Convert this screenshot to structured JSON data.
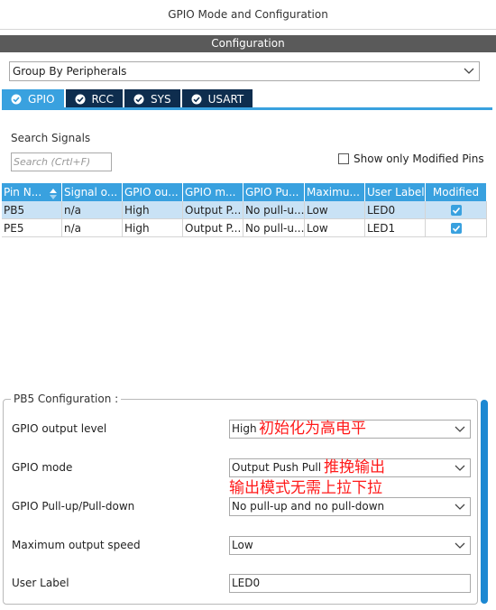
{
  "window": {
    "title": "GPIO Mode and Configuration"
  },
  "config": {
    "header": "Configuration"
  },
  "group_select": {
    "value": "Group By Peripherals"
  },
  "tabs": [
    {
      "label": "GPIO",
      "active": true
    },
    {
      "label": "RCC",
      "active": false
    },
    {
      "label": "SYS",
      "active": false
    },
    {
      "label": "USART",
      "active": false
    }
  ],
  "search": {
    "label": "Search Signals",
    "placeholder": "Search (Crtl+F)",
    "show_modified_label": "Show only Modified Pins"
  },
  "table": {
    "headers": [
      "Pin N...",
      "Signal o...",
      "GPIO ou...",
      "GPIO m...",
      "GPIO Pu...",
      "Maximu...",
      "User Label",
      "Modified"
    ],
    "rows": [
      {
        "pin": "PB5",
        "signal": "n/a",
        "output": "High",
        "mode": "Output P...",
        "pull": "No pull-u...",
        "speed": "Low",
        "label": "LED0",
        "modified": true
      },
      {
        "pin": "PE5",
        "signal": "n/a",
        "output": "High",
        "mode": "Output P...",
        "pull": "No pull-u...",
        "speed": "Low",
        "label": "LED1",
        "modified": true
      }
    ]
  },
  "pin_config": {
    "legend": "PB5 Configuration :",
    "fields": [
      {
        "label": "GPIO output level",
        "value": "High"
      },
      {
        "label": "GPIO mode",
        "value": "Output Push Pull"
      },
      {
        "label": "GPIO Pull-up/Pull-down",
        "value": "No pull-up and no pull-down"
      },
      {
        "label": "Maximum output speed",
        "value": "Low"
      },
      {
        "label": "User Label",
        "value": "LED0"
      }
    ]
  },
  "annotations": {
    "output_level_note": "初始化为高电平",
    "mode_note_1": "推挽输出",
    "mode_note_2": "输出模式无需上拉下拉"
  },
  "colors": {
    "accent": "#39a1df",
    "tab_dark": "#0e2d4e",
    "header_gray": "#5a5a5a",
    "note_red": "#ff1a1a"
  }
}
